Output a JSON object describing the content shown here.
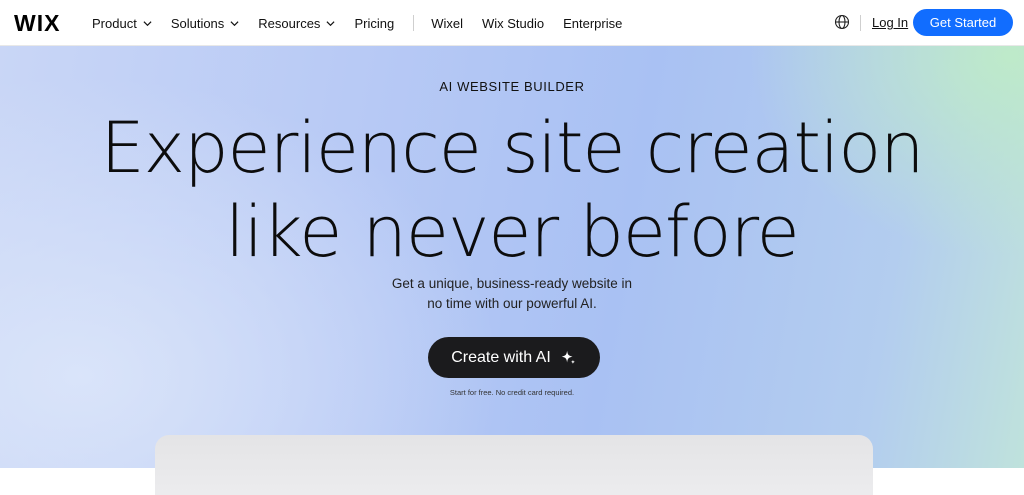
{
  "header": {
    "logo": "WIX",
    "nav": [
      {
        "label": "Product",
        "has_dropdown": true
      },
      {
        "label": "Solutions",
        "has_dropdown": true
      },
      {
        "label": "Resources",
        "has_dropdown": true
      },
      {
        "label": "Pricing",
        "has_dropdown": false
      }
    ],
    "nav_secondary": [
      {
        "label": "Wixel"
      },
      {
        "label": "Wix Studio"
      },
      {
        "label": "Enterprise"
      }
    ],
    "language_icon": "globe-icon",
    "login_label": "Log In",
    "cta_label": "Get Started"
  },
  "hero": {
    "eyebrow": "AI WEBSITE BUILDER",
    "headline_line1": "Experience site creation",
    "headline_line2": "like never before",
    "sub_line1": "Get a unique, business-ready website in",
    "sub_line2": "no time with our powerful AI.",
    "button_label": "Create with AI",
    "button_icon": "sparkle-icon",
    "note": "Start for free. No credit card required."
  },
  "colors": {
    "primary_blue": "#116dff",
    "dark_button": "#1b1b1d"
  }
}
